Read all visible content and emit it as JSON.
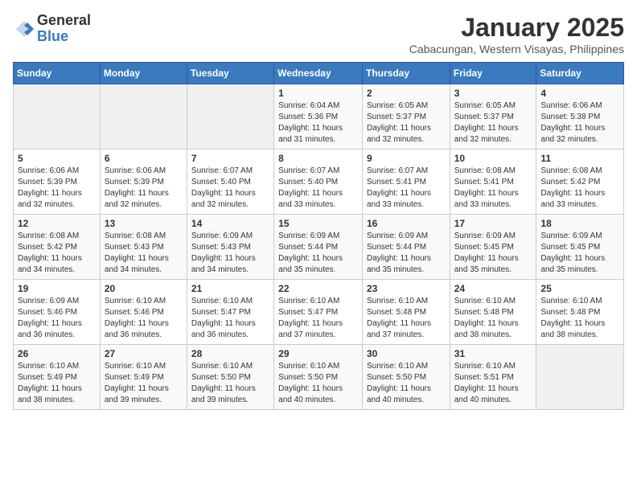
{
  "logo": {
    "general": "General",
    "blue": "Blue"
  },
  "title": {
    "month_year": "January 2025",
    "location": "Cabacungan, Western Visayas, Philippines"
  },
  "weekdays": [
    "Sunday",
    "Monday",
    "Tuesday",
    "Wednesday",
    "Thursday",
    "Friday",
    "Saturday"
  ],
  "weeks": [
    [
      {
        "day": "",
        "info": ""
      },
      {
        "day": "",
        "info": ""
      },
      {
        "day": "",
        "info": ""
      },
      {
        "day": "1",
        "info": "Sunrise: 6:04 AM\nSunset: 5:36 PM\nDaylight: 11 hours\nand 31 minutes."
      },
      {
        "day": "2",
        "info": "Sunrise: 6:05 AM\nSunset: 5:37 PM\nDaylight: 11 hours\nand 32 minutes."
      },
      {
        "day": "3",
        "info": "Sunrise: 6:05 AM\nSunset: 5:37 PM\nDaylight: 11 hours\nand 32 minutes."
      },
      {
        "day": "4",
        "info": "Sunrise: 6:06 AM\nSunset: 5:38 PM\nDaylight: 11 hours\nand 32 minutes."
      }
    ],
    [
      {
        "day": "5",
        "info": "Sunrise: 6:06 AM\nSunset: 5:39 PM\nDaylight: 11 hours\nand 32 minutes."
      },
      {
        "day": "6",
        "info": "Sunrise: 6:06 AM\nSunset: 5:39 PM\nDaylight: 11 hours\nand 32 minutes."
      },
      {
        "day": "7",
        "info": "Sunrise: 6:07 AM\nSunset: 5:40 PM\nDaylight: 11 hours\nand 32 minutes."
      },
      {
        "day": "8",
        "info": "Sunrise: 6:07 AM\nSunset: 5:40 PM\nDaylight: 11 hours\nand 33 minutes."
      },
      {
        "day": "9",
        "info": "Sunrise: 6:07 AM\nSunset: 5:41 PM\nDaylight: 11 hours\nand 33 minutes."
      },
      {
        "day": "10",
        "info": "Sunrise: 6:08 AM\nSunset: 5:41 PM\nDaylight: 11 hours\nand 33 minutes."
      },
      {
        "day": "11",
        "info": "Sunrise: 6:08 AM\nSunset: 5:42 PM\nDaylight: 11 hours\nand 33 minutes."
      }
    ],
    [
      {
        "day": "12",
        "info": "Sunrise: 6:08 AM\nSunset: 5:42 PM\nDaylight: 11 hours\nand 34 minutes."
      },
      {
        "day": "13",
        "info": "Sunrise: 6:08 AM\nSunset: 5:43 PM\nDaylight: 11 hours\nand 34 minutes."
      },
      {
        "day": "14",
        "info": "Sunrise: 6:09 AM\nSunset: 5:43 PM\nDaylight: 11 hours\nand 34 minutes."
      },
      {
        "day": "15",
        "info": "Sunrise: 6:09 AM\nSunset: 5:44 PM\nDaylight: 11 hours\nand 35 minutes."
      },
      {
        "day": "16",
        "info": "Sunrise: 6:09 AM\nSunset: 5:44 PM\nDaylight: 11 hours\nand 35 minutes."
      },
      {
        "day": "17",
        "info": "Sunrise: 6:09 AM\nSunset: 5:45 PM\nDaylight: 11 hours\nand 35 minutes."
      },
      {
        "day": "18",
        "info": "Sunrise: 6:09 AM\nSunset: 5:45 PM\nDaylight: 11 hours\nand 35 minutes."
      }
    ],
    [
      {
        "day": "19",
        "info": "Sunrise: 6:09 AM\nSunset: 5:46 PM\nDaylight: 11 hours\nand 36 minutes."
      },
      {
        "day": "20",
        "info": "Sunrise: 6:10 AM\nSunset: 5:46 PM\nDaylight: 11 hours\nand 36 minutes."
      },
      {
        "day": "21",
        "info": "Sunrise: 6:10 AM\nSunset: 5:47 PM\nDaylight: 11 hours\nand 36 minutes."
      },
      {
        "day": "22",
        "info": "Sunrise: 6:10 AM\nSunset: 5:47 PM\nDaylight: 11 hours\nand 37 minutes."
      },
      {
        "day": "23",
        "info": "Sunrise: 6:10 AM\nSunset: 5:48 PM\nDaylight: 11 hours\nand 37 minutes."
      },
      {
        "day": "24",
        "info": "Sunrise: 6:10 AM\nSunset: 5:48 PM\nDaylight: 11 hours\nand 38 minutes."
      },
      {
        "day": "25",
        "info": "Sunrise: 6:10 AM\nSunset: 5:48 PM\nDaylight: 11 hours\nand 38 minutes."
      }
    ],
    [
      {
        "day": "26",
        "info": "Sunrise: 6:10 AM\nSunset: 5:49 PM\nDaylight: 11 hours\nand 38 minutes."
      },
      {
        "day": "27",
        "info": "Sunrise: 6:10 AM\nSunset: 5:49 PM\nDaylight: 11 hours\nand 39 minutes."
      },
      {
        "day": "28",
        "info": "Sunrise: 6:10 AM\nSunset: 5:50 PM\nDaylight: 11 hours\nand 39 minutes."
      },
      {
        "day": "29",
        "info": "Sunrise: 6:10 AM\nSunset: 5:50 PM\nDaylight: 11 hours\nand 40 minutes."
      },
      {
        "day": "30",
        "info": "Sunrise: 6:10 AM\nSunset: 5:50 PM\nDaylight: 11 hours\nand 40 minutes."
      },
      {
        "day": "31",
        "info": "Sunrise: 6:10 AM\nSunset: 5:51 PM\nDaylight: 11 hours\nand 40 minutes."
      },
      {
        "day": "",
        "info": ""
      }
    ]
  ]
}
